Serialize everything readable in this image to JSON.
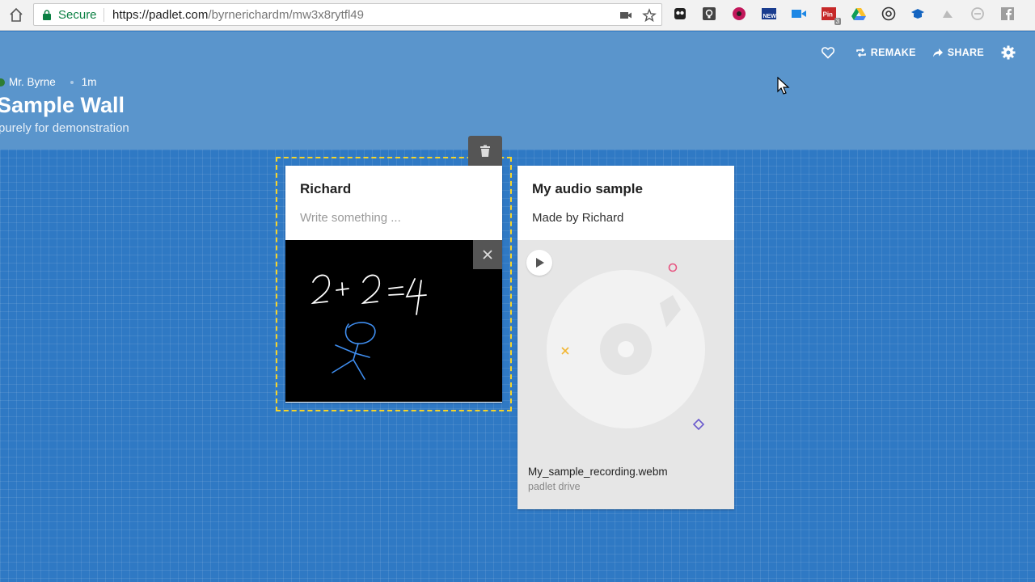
{
  "browser": {
    "secure_label": "Secure",
    "url_host": "https://padlet.com",
    "url_path": "/byrnerichardm/mw3x8rytfl49",
    "ext_badge": "3",
    "icons": [
      "home-icon",
      "lock-icon",
      "camera-icon",
      "star-icon",
      "owl-icon",
      "lightbulb-icon",
      "music-icon",
      "news-icon",
      "screencast-icon",
      "pinterest-icon",
      "drive-icon",
      "chrome-icon",
      "school-icon",
      "cloud-icon",
      "shield-icon",
      "facebook-icon"
    ]
  },
  "header": {
    "author": "Mr. Byrne",
    "time": "1m",
    "title": "Sample Wall",
    "description": "purely for demonstration",
    "actions": {
      "like_icon": "heart-icon",
      "remake": "REMAKE",
      "share": "SHARE",
      "settings_icon": "gear-icon"
    }
  },
  "posts": [
    {
      "title": "Richard",
      "body_placeholder": "Write something ...",
      "attachment": "drawing"
    },
    {
      "title": "My audio sample",
      "body": "Made by Richard",
      "file_name": "My_sample_recording.webm",
      "file_source": "padlet drive"
    }
  ],
  "colors": {
    "header": "#5a95cc",
    "board": "#2f79c4",
    "selection": "#f5d42a",
    "secure": "#0b8043"
  }
}
